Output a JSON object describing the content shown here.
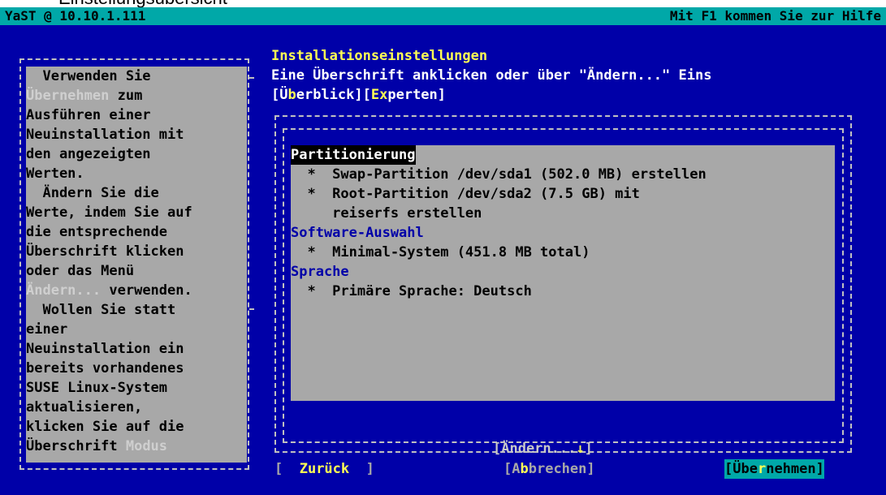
{
  "caption": "Einstellungsübersicht",
  "titlebar": {
    "left": "YaST @ 10.10.1.111",
    "right": "Mit F1 kommen Sie zur Hilfe"
  },
  "help": {
    "lines": [
      "  Verwenden Sie",
      "zum",
      "Ausführen einer",
      "Neuinstallation mit",
      "den angezeigten",
      "Werten.",
      "  Ändern Sie die",
      "Werte, indem Sie auf",
      "die entsprechende",
      "Überschrift klicken",
      "oder das Menü",
      "verwenden.",
      "  Wollen Sie statt",
      "einer",
      "Neuinstallation ein",
      "bereits vorhandenes",
      "SUSE Linux-System",
      "aktualisieren,",
      "klicken Sie auf die",
      "Überschrift"
    ],
    "dim_words": {
      "uebernehmen": "Übernehmen",
      "aendern": "Ändern...",
      "modus": "Modus"
    }
  },
  "main": {
    "heading": "Installationseinstellungen",
    "subheading": "Eine Überschrift anklicken oder über \"Ändern...\" Eins",
    "tabs": {
      "overview_pre": "[Ü",
      "overview_hk": "b",
      "overview_post": "erblick]",
      "expert_pre": "[",
      "expert_hk": "Ex",
      "expert_post": "perten]"
    }
  },
  "overview": {
    "partitioning_title": "Partitionierung",
    "partitioning_items": [
      "  *  Swap-Partition /dev/sda1 (502.0 MB) erstellen",
      "  *  Root-Partition /dev/sda2 (7.5 GB) mit",
      "     reiserfs erstellen"
    ],
    "software_title": "Software-Auswahl",
    "software_items": [
      "  *  Minimal-System (451.8 MB total)"
    ],
    "language_title": "Sprache",
    "language_items": [
      "  *  Primäre Sprache: Deutsch"
    ]
  },
  "buttons": {
    "change_pre": "[Ändern...",
    "change_arrow": "↓",
    "change_post": "]",
    "back_pre": "[  ",
    "back_label": "Zurück",
    "back_post": "  ]",
    "abort_pre": "[A",
    "abort_hk": "b",
    "abort_post": "brechen]",
    "accept_pre": "[Übe",
    "accept_hk": "r",
    "accept_post": "nehmen]"
  }
}
